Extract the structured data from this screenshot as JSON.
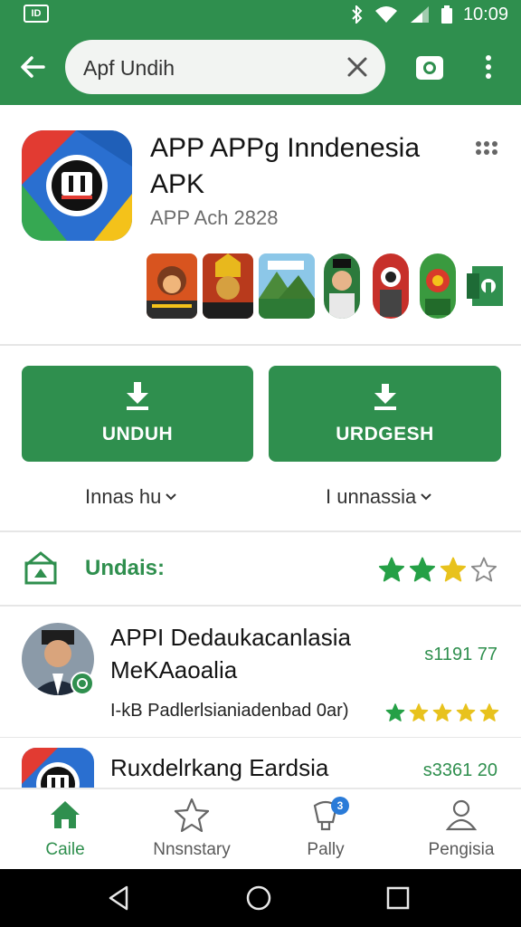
{
  "status_bar": {
    "time": "10:09",
    "left_icon_text": "ID",
    "icons": [
      "bluetooth-icon",
      "wifi-icon",
      "signal-icon",
      "battery-icon"
    ]
  },
  "toolbar": {
    "search_query": "Apf Undih",
    "icons": [
      "back-arrow-icon",
      "clear-icon",
      "camera-icon",
      "more-vert-icon"
    ]
  },
  "app": {
    "title": "APP APPg Inndenesia APK",
    "subtitle": "APP Ach  2828"
  },
  "buttons": {
    "primary_label": "UNDUH",
    "secondary_label": "URDGESH"
  },
  "dropdowns": {
    "left": "Innas hu",
    "right": "I unnassia"
  },
  "rating_section": {
    "label": "Undais:",
    "stars": 2.5,
    "max_stars": 4
  },
  "list": [
    {
      "title": "APPI Dedaukacanlasia MeKAaoalia",
      "count": "s1191 77",
      "desc": "I-kB Padlerlsianiadenbad 0ar)",
      "stars": 5
    },
    {
      "title": "Ruxdelrkang Eardsia",
      "count": "s3361 20"
    }
  ],
  "bottom_nav": [
    {
      "label": "Caile",
      "icon": "home-icon",
      "active": true
    },
    {
      "label": "Nnsnstary",
      "icon": "star-outline-icon",
      "active": false
    },
    {
      "label": "Pally",
      "icon": "gift-icon",
      "active": false,
      "badge": "3"
    },
    {
      "label": "Pengisia",
      "icon": "account-icon",
      "active": false
    }
  ],
  "colors": {
    "brand_green": "#2f8f4e",
    "star_green": "#25a046",
    "star_yellow": "#e8c21d",
    "badge_blue": "#2a7bd8"
  }
}
